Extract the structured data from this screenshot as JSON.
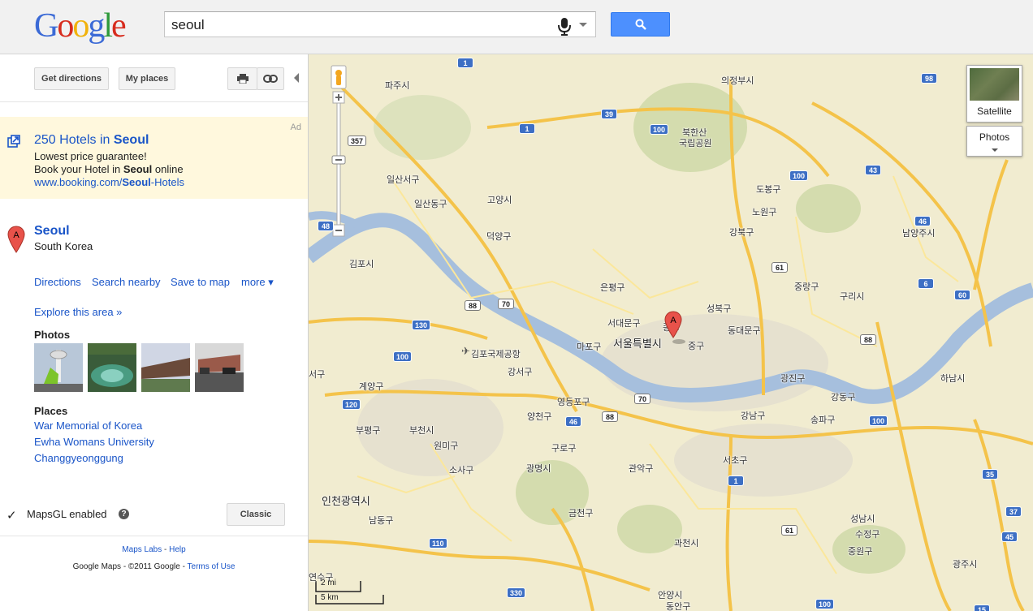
{
  "header": {
    "logo": [
      "G",
      "o",
      "o",
      "g",
      "l",
      "e"
    ],
    "logo_colors": [
      "#3b6ad6",
      "#d72c1e",
      "#f1b20b",
      "#3b6ad6",
      "#2e9a3b",
      "#d72c1e"
    ],
    "search_value": "seoul"
  },
  "toolbar": {
    "get_directions": "Get directions",
    "my_places": "My places"
  },
  "ad": {
    "label": "Ad",
    "title_pre": "250 Hotels in ",
    "title_bold": "Seoul",
    "line1": "Lowest price guarantee!",
    "line2_pre": "Book your Hotel in ",
    "line2_bold": "Seoul",
    "line2_post": " online",
    "url_pre": "www.booking.com/",
    "url_bold": "Seoul",
    "url_post": "-Hotels"
  },
  "result": {
    "marker": "A",
    "name": "Seoul",
    "country": "South Korea",
    "actions": [
      "Directions",
      "Search nearby",
      "Save to map",
      "more ▾"
    ],
    "explore": "Explore this area »",
    "photos_heading": "Photos",
    "places_heading": "Places",
    "places": [
      "War Memorial of Korea",
      "Ewha Womans University",
      "Changgyeonggung"
    ]
  },
  "mapsgl": {
    "check": "✓",
    "label": "MapsGL enabled",
    "help": "?",
    "classic": "Classic"
  },
  "footer": {
    "labs": "Maps Labs",
    "sep1": " - ",
    "help": "Help",
    "copyright": "Google Maps - ©2011 Google - ",
    "terms": "Terms of Use"
  },
  "map": {
    "marker": "A",
    "satellite": "Satellite",
    "photos": "Photos",
    "scale_mi": "2 mi",
    "scale_km": "5 km",
    "labels": {
      "uijeongbu": "의정부시",
      "bukhansan": "북한산",
      "bukhansan2": "국립공원",
      "ilsanseo": "일산서구",
      "ilsandong": "일산동구",
      "goyang": "고양시",
      "deogyang": "덕양구",
      "gimpo": "김포시",
      "paju": "파주시",
      "dobong": "도봉구",
      "nowon": "노원구",
      "gangbuk": "강북구",
      "namyangju": "남양주시",
      "jungnang": "중랑구",
      "guri": "구리시",
      "eunpyeong": "은평구",
      "seodaemun": "서대문구",
      "seongbuk": "성북구",
      "dongdaemun": "동대문구",
      "mapo": "마포구",
      "seoul": "서울특별시",
      "jung": "중구",
      "jongno": "종로",
      "gimpoairport": "김포국제공항",
      "gangseo": "강서구",
      "gyeyang": "계양구",
      "gwangjin": "광진구",
      "gangdong": "강동구",
      "hanam": "하남시",
      "yeongdeungpo": "영등포구",
      "yangcheon": "양천구",
      "gangnam": "강남구",
      "songpa": "송파구",
      "bupyeong": "부평구",
      "bucheon": "부천시",
      "wonmi": "원미구",
      "sosa": "소사구",
      "guro": "구로구",
      "gwangmyeong": "광명시",
      "gwanak": "관악구",
      "seocho": "서초구",
      "incheon": "인천광역시",
      "namdong": "남동구",
      "geumcheon": "금천구",
      "gwacheon": "과천시",
      "seongnam": "성남시",
      "sujeong": "수정구",
      "jungwon": "중원구",
      "gwangju": "광주시",
      "anyang": "안양시",
      "dongan": "동안구",
      "yeonsu": "연수구",
      "seo": "서구",
      "gangdonggu": "강동구"
    },
    "shields": [
      "1",
      "1",
      "39",
      "100",
      "98",
      "100",
      "43",
      "46",
      "6",
      "60",
      "357",
      "48",
      "88",
      "70",
      "130",
      "100",
      "61",
      "88",
      "70",
      "88",
      "46",
      "120",
      "100",
      "1",
      "35",
      "37",
      "45",
      "61",
      "110",
      "330",
      "100",
      "15"
    ]
  }
}
